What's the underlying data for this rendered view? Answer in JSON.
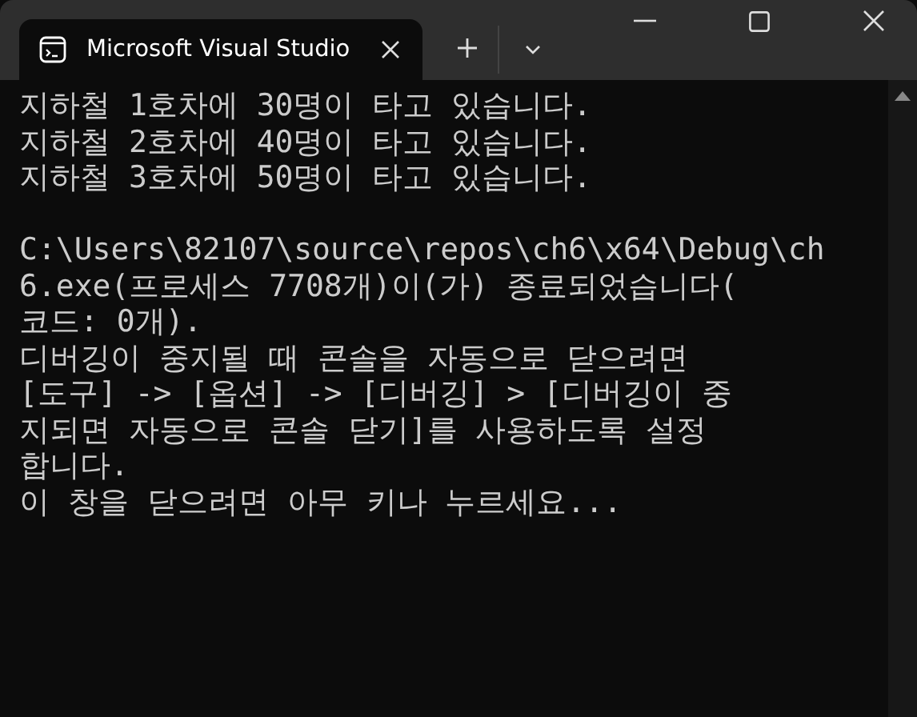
{
  "tabs": [
    {
      "title": "Microsoft Visual Studio",
      "selected": true
    }
  ],
  "console": {
    "output_lines": [
      "지하철 1호차에 30명이 타고 있습니다.",
      "지하철 2호차에 40명이 타고 있습니다.",
      "지하철 3호차에 50명이 타고 있습니다."
    ],
    "exit_lines": [
      "C:\\Users\\82107\\source\\repos\\ch6\\x64\\Debug\\ch",
      "6.exe(프로세스 7708개)이(가) 종료되었습니다(",
      "코드: 0개).",
      "디버깅이 중지될 때 콘솔을 자동으로 닫으려면",
      "[도구] -> [옵션] -> [디버깅] > [디버깅이 중",
      "지되면 자동으로 콘솔 닫기]를 사용하도록 설정",
      "합니다.",
      "이 창을 닫으려면 아무 키나 누르세요..."
    ]
  }
}
